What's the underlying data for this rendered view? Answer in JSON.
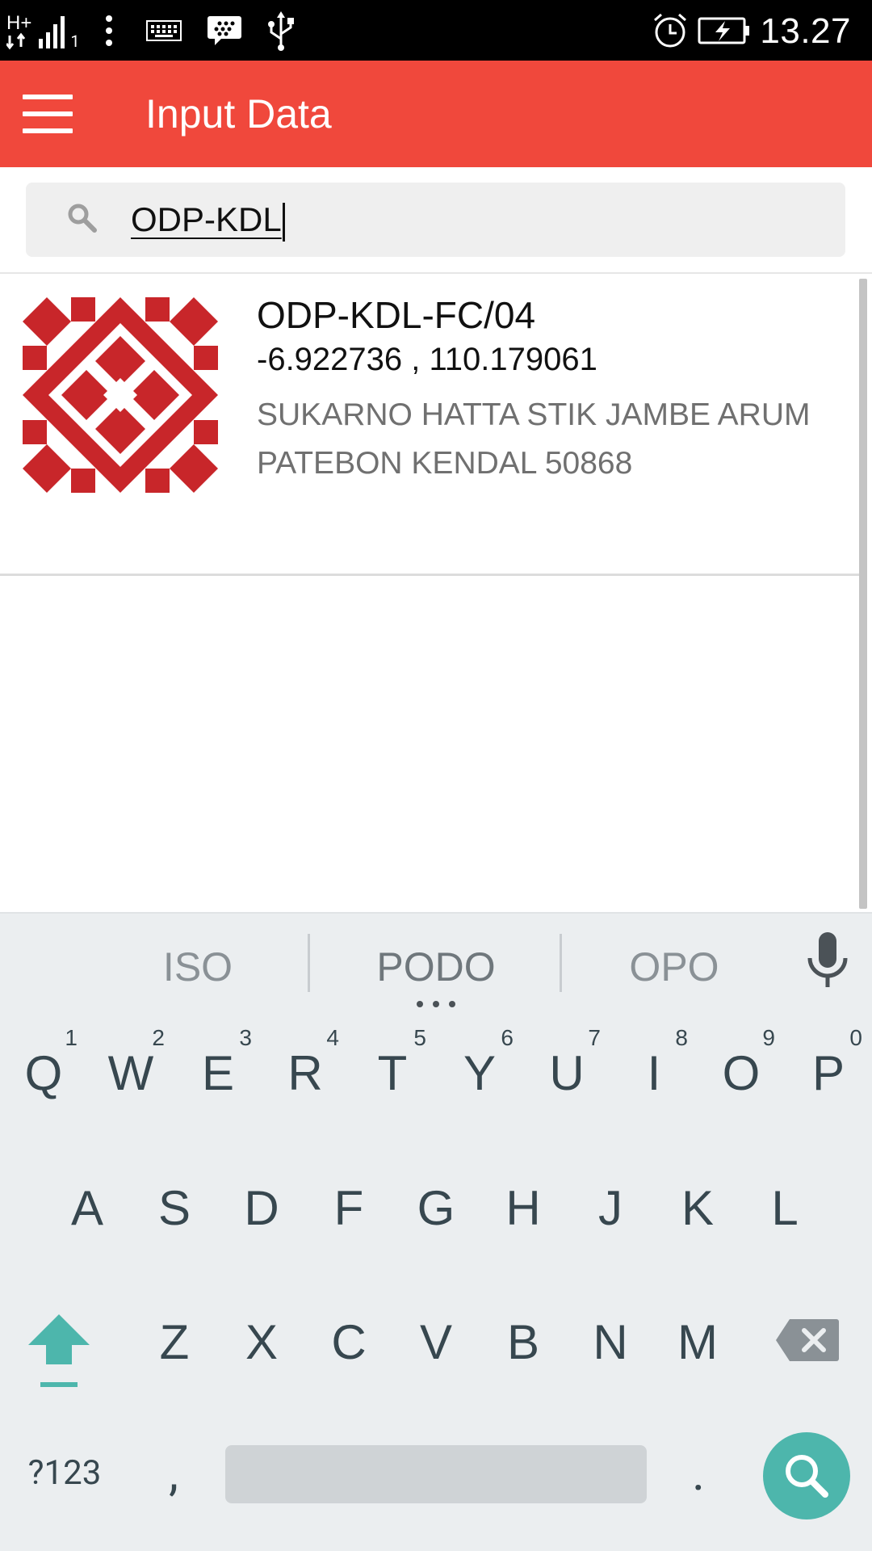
{
  "status_bar": {
    "network": "H+",
    "sim_indicator": "1",
    "time": "13.27",
    "icons": [
      "network-hplus-icon",
      "signal-icon",
      "more-dots-icon",
      "keyboard-icon",
      "bbm-icon",
      "usb-icon",
      "alarm-icon",
      "battery-charging-icon"
    ]
  },
  "app_bar": {
    "title": "Input Data",
    "menu_icon": "hamburger-menu-icon",
    "color": "#f0483c"
  },
  "search": {
    "value": "ODP-KDL",
    "icon": "search-icon"
  },
  "results": [
    {
      "title": "ODP-KDL-FC/04",
      "coordinates": "-6.922736 , 110.179061",
      "address": "SUKARNO HATTA STIK JAMBE ARUM PATEBON KENDAL 50868",
      "logo": "red-diamond-quilt-logo",
      "logo_color": "#c8262a"
    }
  ],
  "keyboard": {
    "suggestions": [
      "ISO",
      "PODO",
      "OPO"
    ],
    "mic_icon": "microphone-icon",
    "row1": [
      {
        "key": "Q",
        "hint": "1"
      },
      {
        "key": "W",
        "hint": "2"
      },
      {
        "key": "E",
        "hint": "3"
      },
      {
        "key": "R",
        "hint": "4"
      },
      {
        "key": "T",
        "hint": "5"
      },
      {
        "key": "Y",
        "hint": "6"
      },
      {
        "key": "U",
        "hint": "7"
      },
      {
        "key": "I",
        "hint": "8"
      },
      {
        "key": "O",
        "hint": "9"
      },
      {
        "key": "P",
        "hint": "0"
      }
    ],
    "row2": [
      "A",
      "S",
      "D",
      "F",
      "G",
      "H",
      "J",
      "K",
      "L"
    ],
    "row3": [
      "Z",
      "X",
      "C",
      "V",
      "B",
      "N",
      "M"
    ],
    "symbols_label": "?123",
    "comma": ",",
    "period": ".",
    "accent_color": "#4db6ac"
  }
}
